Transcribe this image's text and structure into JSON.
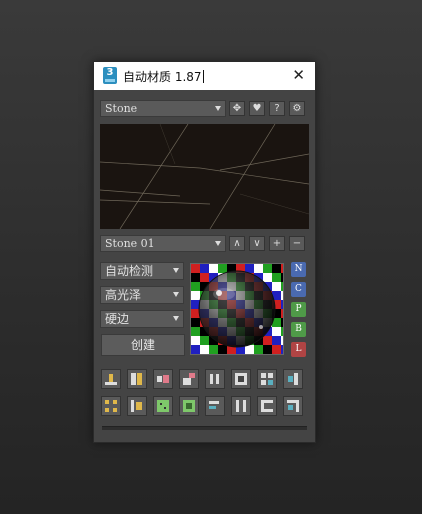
{
  "window": {
    "title": "自动材质 1.87",
    "app_icon_text": "3"
  },
  "material_dropdown": {
    "value": "Stone"
  },
  "top_buttons": [
    {
      "name": "move-icon",
      "glyph": "✥"
    },
    {
      "name": "heart-icon",
      "glyph": "♥"
    },
    {
      "name": "help-icon",
      "glyph": "?"
    },
    {
      "name": "settings-icon",
      "glyph": "⚙"
    }
  ],
  "variant_dropdown": {
    "value": "Stone 01"
  },
  "variant_buttons": [
    {
      "name": "up-button",
      "glyph": "∧"
    },
    {
      "name": "down-button",
      "glyph": "∨"
    },
    {
      "name": "add-button",
      "glyph": "+"
    },
    {
      "name": "remove-button",
      "glyph": "−"
    }
  ],
  "options": {
    "detect": "自动检测",
    "gloss": "高光泽",
    "edge": "硬边",
    "create_label": "创建"
  },
  "map_buttons": [
    {
      "label": "N",
      "color": "#4a6ab0"
    },
    {
      "label": "C",
      "color": "#4a6ab0"
    },
    {
      "label": "P",
      "color": "#4f9a48"
    },
    {
      "label": "B",
      "color": "#4f9a48"
    },
    {
      "label": "L",
      "color": "#b04444"
    }
  ],
  "tool_icons_row1": [
    "align-bottom-icon",
    "split-vertical-icon",
    "align-left-icon",
    "corner-icon",
    "distribute-icon",
    "frame-icon",
    "grid-icon",
    "align-right-icon"
  ],
  "tool_icons_row2": [
    "selection-corners-icon",
    "align-top-icon",
    "dots-icon",
    "square-icon",
    "align-text-icon",
    "columns-icon",
    "rotate-icon",
    "corner-top-icon"
  ],
  "colors": {
    "accent_yellow": "#e0b84a",
    "accent_pink": "#e07a8a",
    "accent_teal": "#5ab0c0",
    "accent_green": "#7ec86a"
  }
}
